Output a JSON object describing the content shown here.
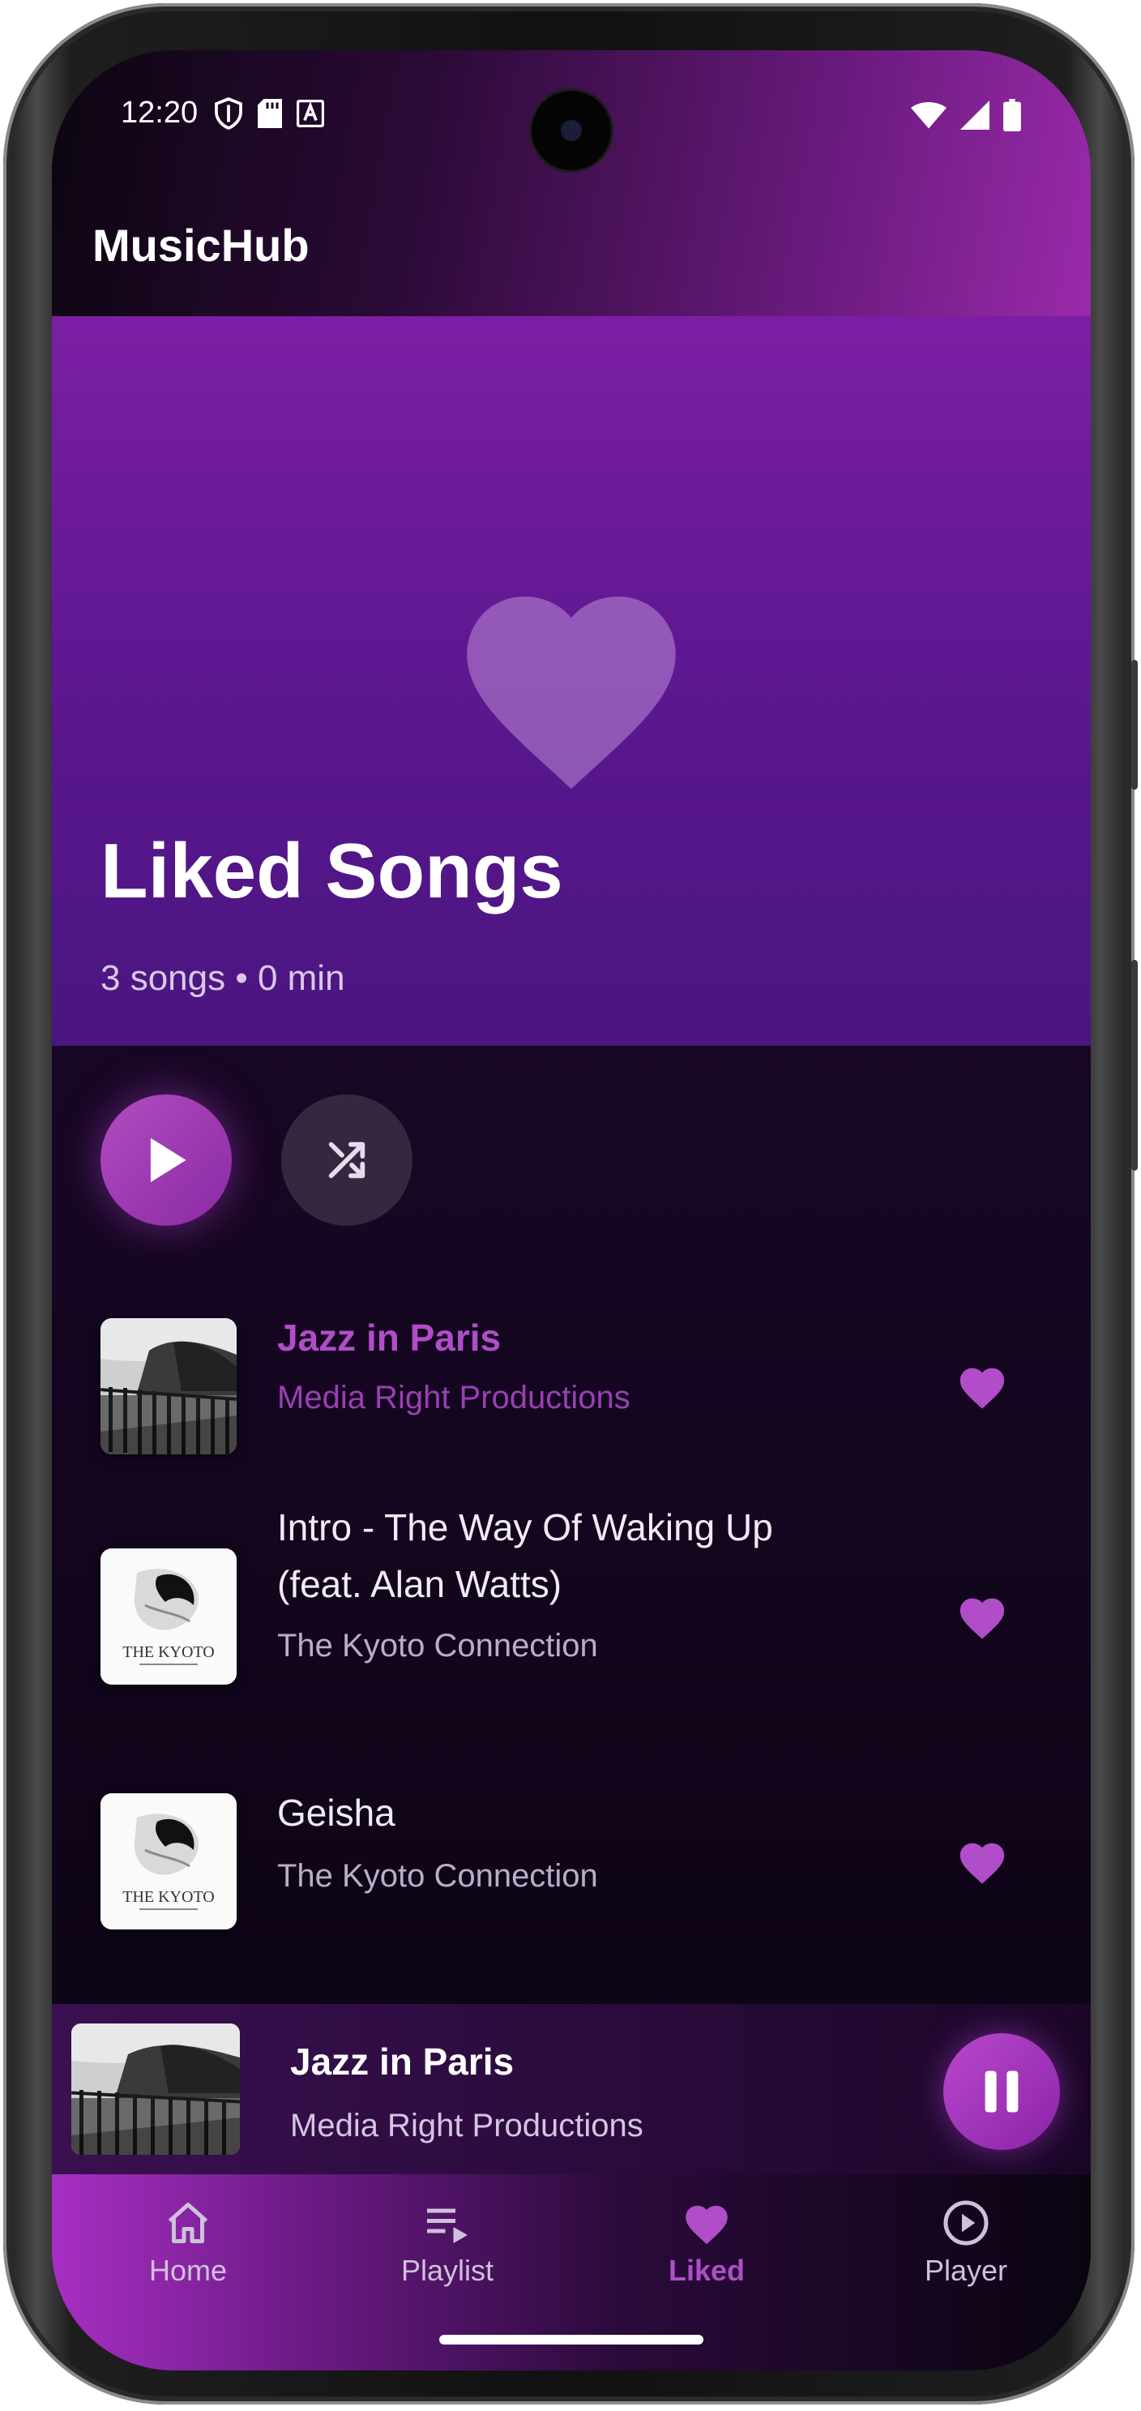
{
  "status_bar": {
    "time": "12:20"
  },
  "app": {
    "title": "MusicHub"
  },
  "hero": {
    "title": "Liked Songs",
    "subtitle": "3 songs • 0 min"
  },
  "songs": [
    {
      "title": "Jazz in Paris",
      "artist": "Media Right Productions",
      "active": true
    },
    {
      "title_line1": "Intro - The Way Of Waking Up",
      "title_line2": "(feat. Alan Watts)",
      "artist": "The Kyoto Connection"
    },
    {
      "title": "Geisha",
      "artist": "The Kyoto Connection"
    }
  ],
  "album_art_text": "THE KYOTO",
  "mini_player": {
    "title": "Jazz in Paris",
    "artist": "Media Right Productions"
  },
  "nav": [
    {
      "label": "Home",
      "icon": "home-icon"
    },
    {
      "label": "Playlist",
      "icon": "playlist-icon"
    },
    {
      "label": "Liked",
      "icon": "heart-icon",
      "active": true
    },
    {
      "label": "Player",
      "icon": "play-circle-icon"
    }
  ],
  "colors": {
    "accent": "#b14dc9",
    "hero_top": "#7c1ea4",
    "background": "#14061f"
  }
}
